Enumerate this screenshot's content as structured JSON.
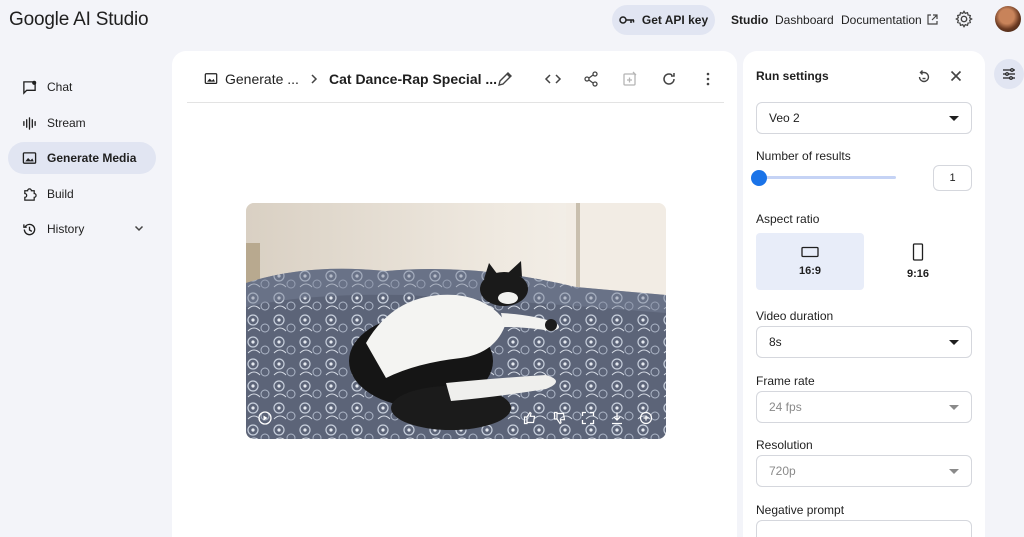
{
  "app": {
    "logo": "Google AI Studio"
  },
  "topbar": {
    "api_key": "Get API key",
    "links": [
      "Studio",
      "Dashboard",
      "Documentation"
    ]
  },
  "sidebar": {
    "items": [
      {
        "label": "Chat",
        "icon": "chat-icon"
      },
      {
        "label": "Stream",
        "icon": "waveform-icon"
      },
      {
        "label": "Generate Media",
        "icon": "media-icon",
        "active": true
      },
      {
        "label": "Build",
        "icon": "puzzle-icon"
      },
      {
        "label": "History",
        "icon": "history-icon"
      }
    ]
  },
  "main": {
    "breadcrumb": "Generate ...",
    "title": "Cat Dance-Rap Special ..."
  },
  "settings": {
    "title": "Run settings",
    "model": "Veo 2",
    "num_results_label": "Number of results",
    "num_results_value": "1",
    "aspect_label": "Aspect ratio",
    "aspect_options": [
      "16:9",
      "9:16"
    ],
    "aspect_selected": "16:9",
    "duration_label": "Video duration",
    "duration_value": "8s",
    "framerate_label": "Frame rate",
    "framerate_value": "24 fps",
    "resolution_label": "Resolution",
    "resolution_value": "720p",
    "negative_label": "Negative prompt"
  },
  "colors": {
    "accent": "#1a73e8",
    "page_bg": "#f3f4f9",
    "active_nav": "#e1e5f2"
  }
}
